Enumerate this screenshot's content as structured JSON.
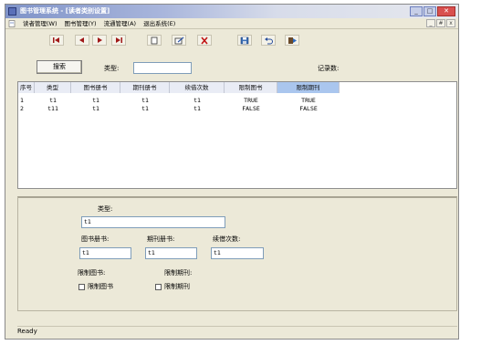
{
  "window": {
    "title": "图书管理系统 - [读者类别设置]",
    "controls": {
      "minimize": "_",
      "maximize": "□",
      "close": "✕"
    }
  },
  "menubar": {
    "items": [
      "读者管理(W)",
      "图书管理(Y)",
      "流通管理(A)",
      "退出系统(E)"
    ],
    "mdi_controls": [
      "_",
      "#",
      "x"
    ]
  },
  "toolbar": {
    "buttons": [
      {
        "icon": "first-record-icon"
      },
      {
        "icon": "previous-record-icon"
      },
      {
        "icon": "next-record-icon"
      },
      {
        "icon": "last-record-icon"
      },
      {
        "icon": "new-document-icon"
      },
      {
        "icon": "edit-icon"
      },
      {
        "icon": "delete-icon"
      },
      {
        "icon": "save-icon"
      },
      {
        "icon": "undo-icon"
      },
      {
        "icon": "exit-icon"
      }
    ]
  },
  "search": {
    "button_label": "搜索",
    "type_label": "类型:",
    "type_value": "",
    "record_count_label": "记录数:"
  },
  "grid": {
    "columns": [
      "序号",
      "类型",
      "图书册书",
      "期刊册书",
      "续借次数",
      "限制图书",
      "限制期刊"
    ],
    "selected_column": 6,
    "rows": [
      [
        "1",
        "t1",
        "t1",
        "t1",
        "t1",
        "TRUE",
        "TRUE"
      ],
      [
        "2",
        "t11",
        "t1",
        "t1",
        "t1",
        "FALSE",
        "FALSE"
      ]
    ]
  },
  "detail": {
    "type_label": "类型:",
    "type_value": "t1",
    "book_count_label": "图书册书:",
    "book_count_value": "t1",
    "journal_count_label": "期刊册书:",
    "journal_count_value": "t1",
    "renew_label": "续借次数:",
    "renew_value": "t1",
    "limit_book_label": "限制图书:",
    "limit_book_checkbox": "限制图书",
    "limit_book_checked": false,
    "limit_journal_label": "限制期刊:",
    "limit_journal_checkbox": "限制期刊",
    "limit_journal_checked": false
  },
  "status": {
    "text": "Ready"
  },
  "colors": {
    "title_gradient_start": "#7f93c8",
    "grid_header_selected": "#aac6ee",
    "input_border": "#7f9db9"
  }
}
